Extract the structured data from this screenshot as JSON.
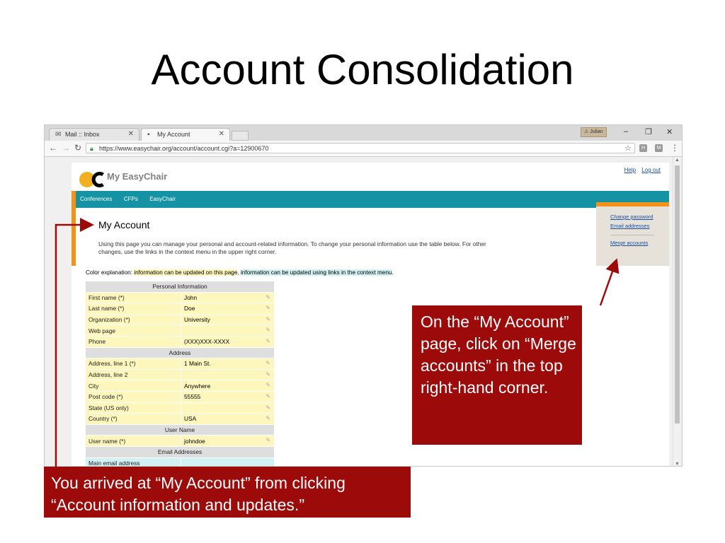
{
  "slide": {
    "title": "Account Consolidation"
  },
  "browser": {
    "tabs": [
      {
        "label": "Mail :: Inbox",
        "icon": "mail-icon"
      },
      {
        "label": "My Account",
        "icon": "page-icon"
      }
    ],
    "profile": "Julian",
    "url": "https://www.easychair.org/account/account.cgi?a=12900670"
  },
  "site": {
    "brand": "My EasyChair",
    "top_links": [
      "Help",
      "Log out"
    ],
    "nav": [
      "Conferences",
      "CFPs",
      "EasyChair"
    ],
    "page_title": "My Account",
    "intro": "Using this page you can manage your personal and account-related information. To change your personal information use the table below. For other changes, use the links in the context menu in the upper right corner.",
    "context_menu": [
      "Change password",
      "Email addresses",
      "Merge accounts"
    ],
    "color_explanation": {
      "prefix": "Color explanation: ",
      "yellow": "information can be updated on this page",
      "sep": ", ",
      "blue": "information can be updated using links in the context menu",
      "suffix": "."
    },
    "colors": {
      "teal": "#1592a4",
      "orange": "#f29218",
      "yellow": "#fdf6bd",
      "blue": "#d2f1f2"
    }
  },
  "table": {
    "sections": [
      {
        "title": "Personal Information",
        "rows": [
          {
            "label": "First name (*)",
            "value": "John"
          },
          {
            "label": "Last name (*)",
            "value": "Doe"
          },
          {
            "label": "Organization (*)",
            "value": "University"
          },
          {
            "label": "Web page",
            "value": ""
          },
          {
            "label": "Phone",
            "value": "(XXX)XXX-XXXX"
          }
        ]
      },
      {
        "title": "Address",
        "rows": [
          {
            "label": "Address, line 1 (*)",
            "value": "1 Main St."
          },
          {
            "label": "Address, line 2",
            "value": ""
          },
          {
            "label": "City",
            "value": "Anywhere"
          },
          {
            "label": "Post code (*)",
            "value": "55555"
          },
          {
            "label": "State (US only)",
            "value": ""
          },
          {
            "label": "Country (*)",
            "value": "USA"
          }
        ]
      },
      {
        "title": "User Name",
        "rows": [
          {
            "label": "User name (*)",
            "value": "johndoe"
          }
        ]
      },
      {
        "title": "Email Addresses",
        "rows": [
          {
            "label": "Main email address",
            "value": ""
          }
        ]
      }
    ]
  },
  "callouts": {
    "right": "On the “My Account” page, click on “Merge accounts” in the top right-hand corner.",
    "bottom": "You arrived at “My Account” from clicking “Account information and updates.”"
  }
}
